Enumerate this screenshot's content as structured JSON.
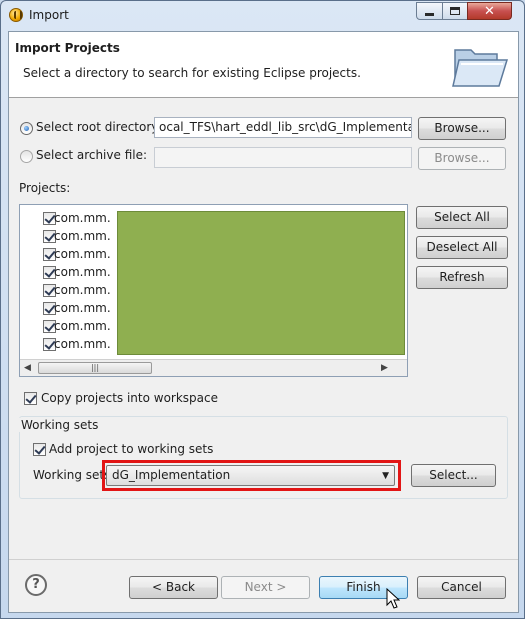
{
  "window": {
    "title": "Import"
  },
  "banner": {
    "title": "Import Projects",
    "description": "Select a directory to search for existing Eclipse projects."
  },
  "source": {
    "root_label": "Select root directory:",
    "root_selected": true,
    "root_path": "ocal_TFS\\hart_eddl_lib_src\\dG_Implementation",
    "archive_label": "Select archive file:",
    "archive_path": "",
    "browse_label": "Browse...",
    "browse_archive_label": "Browse..."
  },
  "projects": {
    "label": "Projects:",
    "items": [
      {
        "label": "com.mm.",
        "checked": true
      },
      {
        "label": "com.mm.",
        "checked": true
      },
      {
        "label": "com.mm.",
        "checked": true
      },
      {
        "label": "com.mm.",
        "checked": true
      },
      {
        "label": "com.mm.",
        "checked": true
      },
      {
        "label": "com.mm.",
        "checked": true
      },
      {
        "label": "com.mm.",
        "checked": true
      },
      {
        "label": "com.mm.",
        "checked": true
      }
    ],
    "select_all": "Select All",
    "deselect_all": "Deselect All",
    "refresh": "Refresh"
  },
  "options": {
    "copy_label": "Copy projects into workspace",
    "copy_checked": true
  },
  "working_sets": {
    "group_label": "Working sets",
    "add_label": "Add project to working sets",
    "add_checked": true,
    "sets_label": "Working sets:",
    "selected_value": "dG_Implementation",
    "select_button": "Select..."
  },
  "footer": {
    "back": "< Back",
    "next": "Next >",
    "finish": "Finish",
    "cancel": "Cancel"
  },
  "colors": {
    "highlight": "#e21515",
    "redaction": "#8faf50"
  },
  "icons": [
    "app-icon",
    "folder-icon",
    "help-icon",
    "cursor-icon"
  ]
}
